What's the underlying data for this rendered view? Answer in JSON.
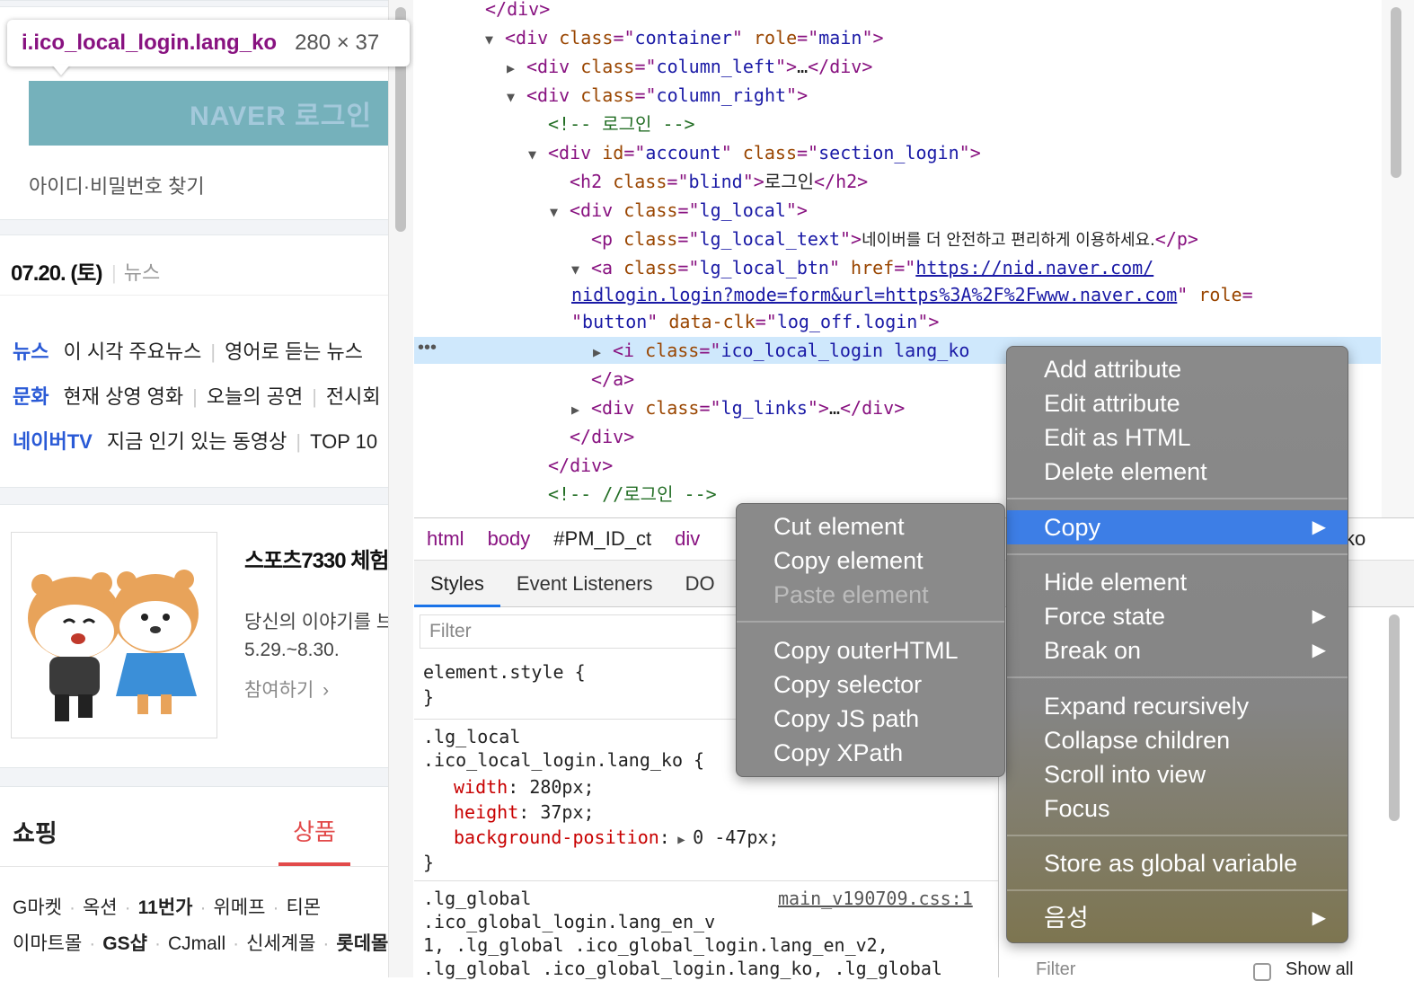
{
  "page": {
    "tooltip": {
      "selector": "i.ico_local_login.lang_ko",
      "size": "280 × 37"
    },
    "login_button_text": "NAVER 로그인",
    "find_id_pw": "아이디·비밀번호 찾기",
    "date": "07.20. (토)",
    "date_tab": "뉴스",
    "news_rows": [
      {
        "cat": "뉴스",
        "items": [
          "이 시각 주요뉴스",
          "영어로 듣는 뉴스"
        ]
      },
      {
        "cat": "문화",
        "items": [
          "현재 상영 영화",
          "오늘의 공연",
          "전시회"
        ]
      },
      {
        "cat": "네이버TV",
        "items": [
          "지금 인기 있는 동영상",
          "TOP 10"
        ]
      }
    ],
    "promo": {
      "title": "스포츠7330 체험",
      "desc": "당신의 이야기를 브",
      "period": "5.29.~8.30.",
      "join": "참여하기"
    },
    "shopping": {
      "title": "쇼핑",
      "tab": "상품",
      "row1": [
        "G마켓",
        "옥션",
        "11번가",
        "위메프",
        "티몬"
      ],
      "row2": [
        "이마트몰",
        "GS샵",
        "CJmall",
        "신세계몰",
        "롯데몰"
      ]
    }
  },
  "dom": {
    "l0": "</div>",
    "l1": {
      "tag": "div",
      "a1": "class",
      "v1": "container",
      "a2": "role",
      "v2": "main"
    },
    "l2": {
      "tag": "div",
      "a1": "class",
      "v1": "column_left"
    },
    "l3": {
      "tag": "div",
      "a1": "class",
      "v1": "column_right"
    },
    "l4": "<!-- 로그인 -->",
    "l5": {
      "tag": "div",
      "a1": "id",
      "v1": "account",
      "a2": "class",
      "v2": "section_login"
    },
    "l6": {
      "tag": "h2",
      "a1": "class",
      "v1": "blind",
      "text": "로그인"
    },
    "l7": {
      "tag": "div",
      "a1": "class",
      "v1": "lg_local"
    },
    "l8": {
      "tag": "p",
      "a1": "class",
      "v1": "lg_local_text",
      "text": "네이버를 더 안전하고 편리하게 이용하세요."
    },
    "l9": {
      "tag": "a",
      "a1": "class",
      "v1": "lg_local_btn",
      "a2": "href",
      "url1": "https://nid.naver.com/",
      "url2": "nidlogin.login?mode=form&url=https%3A%2F%2Fwww.naver.com",
      "a3": "role",
      "v3": "button",
      "a4": "data-clk",
      "v4": "log_off.login"
    },
    "l10": {
      "tag": "i",
      "a1": "class",
      "v1": "ico_local_login lang_ko"
    },
    "l11": "</a>",
    "l12": {
      "tag": "div",
      "a1": "class",
      "v1": "lg_links"
    },
    "l13": "</div>",
    "l14": "</div>",
    "l15": "<!-- //로그인 -->",
    "ellipsis": "…"
  },
  "breadcrumbs": [
    "html",
    "body",
    "#PM_ID_ct",
    "div"
  ],
  "tabs": [
    "Styles",
    "Event Listeners",
    "DO"
  ],
  "filter_placeholder": "Filter",
  "styles": {
    "element_style": "element.style {",
    "rule1_sel1": ".lg_local",
    "rule1_sel2": ".ico_local_login.lang_ko {",
    "p1": "width",
    "v1": "280px;",
    "p2": "height",
    "v2": "37px;",
    "p3": "background-position",
    "v3": "0 -47px;",
    "rule2_sel1": ".lg_global",
    "rule2_source": "main_v190709.css:1",
    "rule2_sel2": ".ico_global_login.lang_en_v",
    "rule2_sel3": "1, .lg_global .ico_global_login.lang_en_v2,",
    "rule2_sel4": ".lg_global .ico_global_login.lang_ko, .lg_global",
    "side_filter": "Filter",
    "show_all": "Show all",
    "tail": "ko"
  },
  "menu_main": [
    "Add attribute",
    "Edit attribute",
    "Edit as HTML",
    "Delete element",
    "Copy",
    "Hide element",
    "Force state",
    "Break on",
    "Expand recursively",
    "Collapse children",
    "Scroll into view",
    "Focus",
    "Store as global variable",
    "음성"
  ],
  "menu_sub": [
    "Cut element",
    "Copy element",
    "Paste element",
    "Copy outerHTML",
    "Copy selector",
    "Copy JS path",
    "Copy XPath"
  ],
  "colors": {
    "accent": "#3d7ee6",
    "tag": "#881280",
    "attr": "#994500",
    "value": "#1a1aa6",
    "comment": "#236e25"
  }
}
